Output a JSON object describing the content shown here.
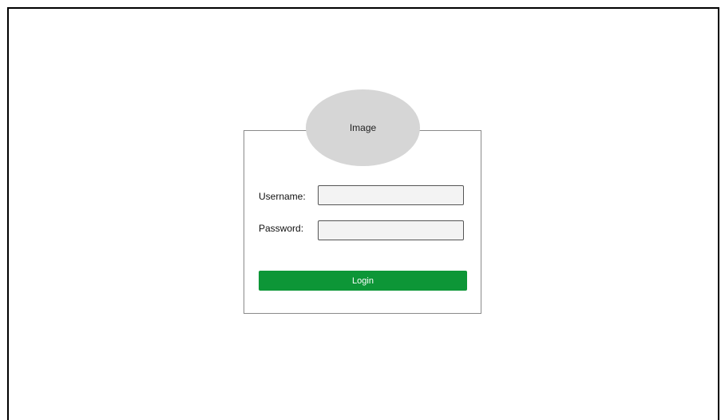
{
  "avatar": {
    "label": "Image"
  },
  "form": {
    "username_label": "Username:",
    "username_value": "",
    "password_label": "Password:",
    "password_value": ""
  },
  "login_button": {
    "label": "Login"
  },
  "colors": {
    "login_button": "#0d9637",
    "avatar_placeholder": "#d6d6d6",
    "input_background": "#f3f3f3"
  }
}
